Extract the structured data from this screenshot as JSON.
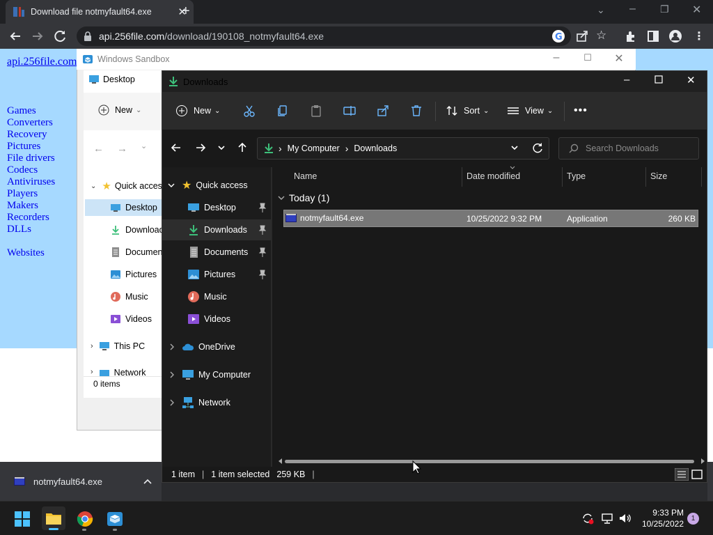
{
  "browser": {
    "tab_title": "Download file notmyfault64.exe",
    "url_host": "api.256file.com",
    "url_path": "/download/190108_notmyfault64.exe"
  },
  "website": {
    "logo_link": "api.256file.com",
    "nav": [
      "Games",
      "Converters",
      "Recovery",
      "Pictures",
      "File drivers",
      "Codecs",
      "Antiviruses",
      "Players",
      "Makers",
      "Recorders",
      "DLLs"
    ],
    "websites_link": "Websites"
  },
  "sandbox": {
    "title": "Windows Sandbox"
  },
  "light_explorer": {
    "title": "Desktop",
    "new_label": "New",
    "quick_access": "Quick access",
    "items": [
      "Desktop",
      "Downloads",
      "Documents",
      "Pictures",
      "Music",
      "Videos"
    ],
    "this_pc": "This PC",
    "network": "Network",
    "status": "0 items"
  },
  "explorer": {
    "title": "Downloads",
    "cmd": {
      "new": "New",
      "sort": "Sort",
      "view": "View"
    },
    "breadcrumb": [
      "My Computer",
      "Downloads"
    ],
    "search_placeholder": "Search Downloads",
    "nav": {
      "quick_access": "Quick access",
      "pinned": [
        "Desktop",
        "Downloads",
        "Documents",
        "Pictures"
      ],
      "others": [
        "Music",
        "Videos"
      ],
      "onedrive": "OneDrive",
      "my_computer": "My Computer",
      "network": "Network"
    },
    "columns": {
      "name": "Name",
      "date": "Date modified",
      "type": "Type",
      "size": "Size"
    },
    "group": "Today (1)",
    "file": {
      "name": "notmyfault64.exe",
      "date": "10/25/2022 9:32 PM",
      "type": "Application",
      "size": "260 KB"
    },
    "status": {
      "items": "1 item",
      "selected": "1 item selected",
      "size": "259 KB"
    }
  },
  "download_shelf": {
    "file": "notmyfault64.exe"
  },
  "taskbar": {
    "time": "9:33 PM",
    "date": "10/25/2022",
    "badge": "1"
  },
  "colors": {
    "accent_blue": "#a6d9ff",
    "link": "#0000ee",
    "download_green": "#3dbf7a",
    "folder_yellow": "#f2c230"
  }
}
